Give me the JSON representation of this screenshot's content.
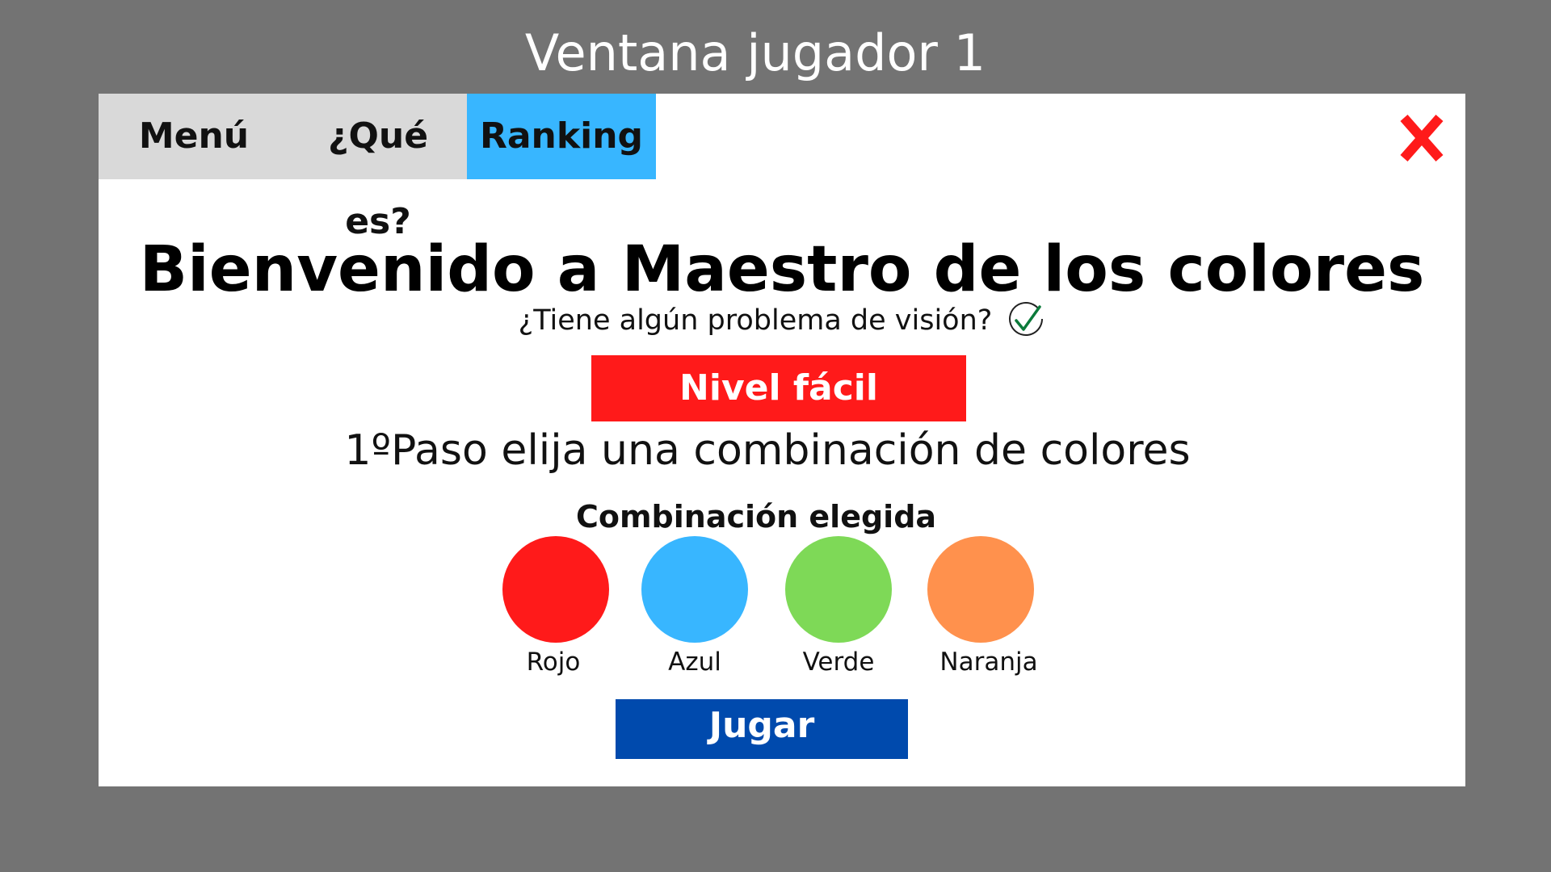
{
  "window_title": "Ventana jugador 1",
  "nav": {
    "items": [
      {
        "label": "Menú"
      },
      {
        "label": "¿Qué es?"
      },
      {
        "label": "Ranking",
        "active": true
      }
    ],
    "active_color": "#38b6ff"
  },
  "close": {
    "icon": "close-x-icon",
    "color": "#ff1a1a"
  },
  "main": {
    "headline": "Bienvenido a Maestro de los colores",
    "vision_question": "¿Tiene algún problema de visión?",
    "vision_icon": "checkmark-circle-icon",
    "level_button": "Nivel fácil",
    "step_text": "1ºPaso elija una combinación de colores",
    "combination_title": "Combinación elegida",
    "colors": [
      {
        "label": "Rojo",
        "hex": "#ff1a1a"
      },
      {
        "label": "Azul",
        "hex": "#38b6ff"
      },
      {
        "label": "Verde",
        "hex": "#7ed957"
      },
      {
        "label": "Naranja",
        "hex": "#ff914d"
      }
    ],
    "play_button": "Jugar"
  },
  "colors": {
    "background": "#737373",
    "level_button": "#ff1a1a",
    "play_button": "#004aad"
  }
}
